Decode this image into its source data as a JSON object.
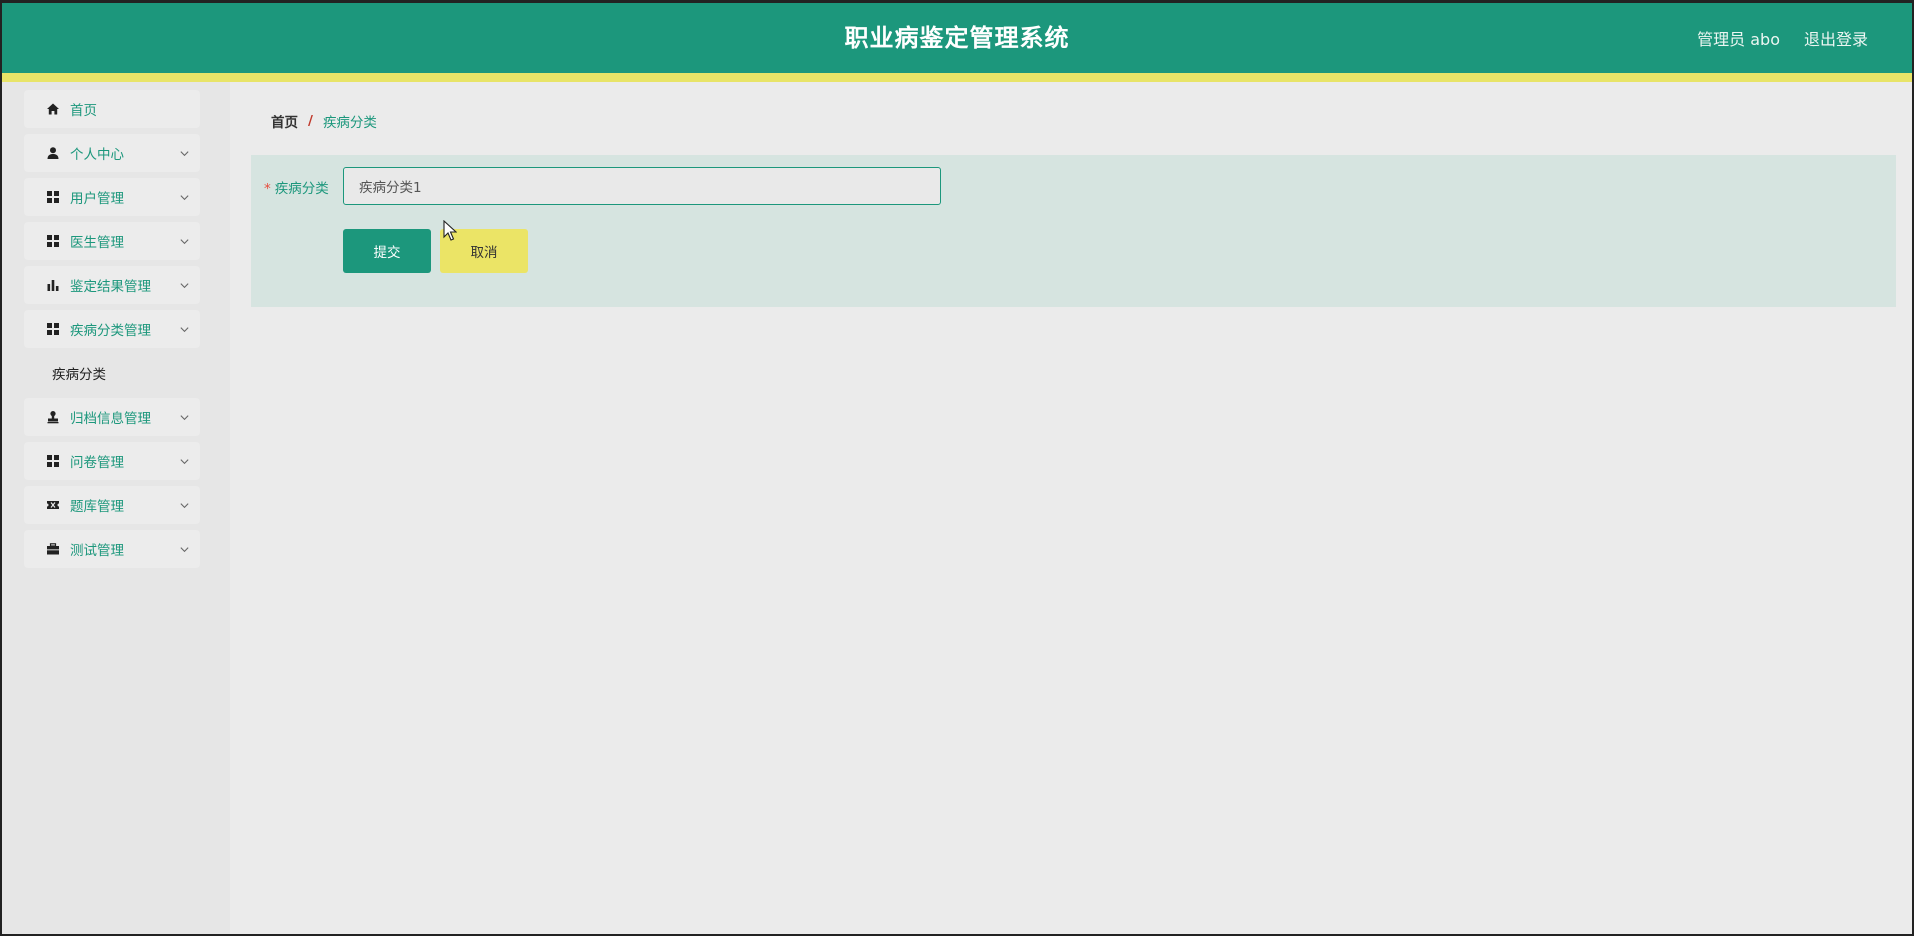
{
  "header": {
    "title": "职业病鉴定管理系统",
    "user": "管理员 abo",
    "logout": "退出登录"
  },
  "sidebar": {
    "items": [
      {
        "label": "首页",
        "icon": "home-icon",
        "chevron": false
      },
      {
        "label": "个人中心",
        "icon": "user-icon",
        "chevron": true
      },
      {
        "label": "用户管理",
        "icon": "grid-icon",
        "chevron": true
      },
      {
        "label": "医生管理",
        "icon": "grid-icon",
        "chevron": true
      },
      {
        "label": "鉴定结果管理",
        "icon": "bar-chart-icon",
        "chevron": true
      },
      {
        "label": "疾病分类管理",
        "icon": "grid-icon",
        "chevron": true
      },
      {
        "label": "归档信息管理",
        "icon": "stamp-icon",
        "chevron": true
      },
      {
        "label": "问卷管理",
        "icon": "grid-icon",
        "chevron": true
      },
      {
        "label": "题库管理",
        "icon": "ticket-icon",
        "chevron": true
      },
      {
        "label": "测试管理",
        "icon": "briefcase-icon",
        "chevron": true
      }
    ],
    "submenu": [
      {
        "label": "疾病分类"
      }
    ]
  },
  "breadcrumb": {
    "home": "首页",
    "separator": "/",
    "current": "疾病分类"
  },
  "form": {
    "field_label": "疾病分类",
    "required_mark": "*",
    "field_value": "疾病分类1",
    "submit_label": "提交",
    "cancel_label": "取消"
  },
  "colors": {
    "primary": "#1c977c",
    "accent_yellow": "#e8e468",
    "panel": "#d6e4e0",
    "required": "#e74c3c"
  }
}
